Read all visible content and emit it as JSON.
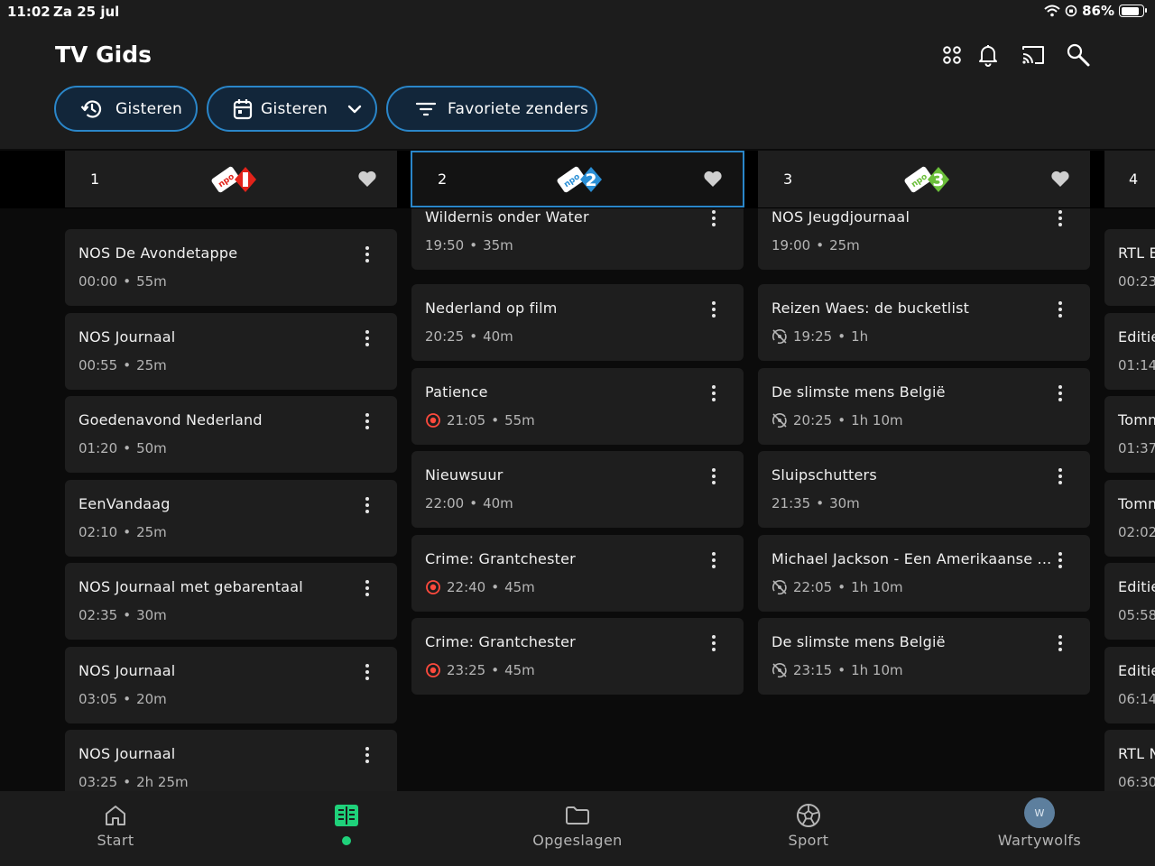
{
  "status_bar": {
    "time": "11:02",
    "date": "Za 25 jul",
    "battery": "86%"
  },
  "header": {
    "title": "TV Gids"
  },
  "filters": [
    {
      "label": "Gisteren",
      "icon": "history-icon"
    },
    {
      "label": "Gisteren",
      "icon": "calendar-icon"
    },
    {
      "label": "Favoriete zenders",
      "icon": "filter-icon"
    }
  ],
  "channels": [
    {
      "number": "1",
      "logo": "npo-1-logo",
      "accent": "#e2231a"
    },
    {
      "number": "2",
      "logo": "npo-2-logo",
      "accent": "#2a8fd6"
    },
    {
      "number": "3",
      "logo": "npo-3-logo",
      "accent": "#6bbf3a"
    },
    {
      "number": "4"
    }
  ],
  "columns": [
    [
      {
        "title": "NOS De Avondetappe",
        "time": "00:00",
        "duration": "55m"
      },
      {
        "title": "NOS Journaal",
        "time": "00:55",
        "duration": "25m"
      },
      {
        "title": "Goedenavond Nederland",
        "time": "01:20",
        "duration": "50m"
      },
      {
        "title": "EenVandaag",
        "time": "02:10",
        "duration": "25m"
      },
      {
        "title": "NOS Journaal met gebarentaal",
        "time": "02:35",
        "duration": "30m"
      },
      {
        "title": "NOS Journaal",
        "time": "03:05",
        "duration": "20m"
      },
      {
        "title": "NOS Journaal",
        "time": "03:25",
        "duration": "2h 25m"
      }
    ],
    [
      {
        "title": "Wildernis onder Water",
        "time": "19:50",
        "duration": "35m"
      },
      {
        "title": "Nederland op film",
        "time": "20:25",
        "duration": "40m"
      },
      {
        "title": "Patience",
        "time": "21:05",
        "duration": "55m",
        "badge": "record"
      },
      {
        "title": "Nieuwsuur",
        "time": "22:00",
        "duration": "40m"
      },
      {
        "title": "Crime: Grantchester",
        "time": "22:40",
        "duration": "45m",
        "badge": "record"
      },
      {
        "title": "Crime: Grantchester",
        "time": "23:25",
        "duration": "45m",
        "badge": "record"
      }
    ],
    [
      {
        "title": "NOS Jeugdjournaal",
        "time": "19:00",
        "duration": "25m"
      },
      {
        "title": "Reizen Waes: de bucketlist",
        "time": "19:25",
        "duration": "1h",
        "badge": "no-record"
      },
      {
        "title": "De slimste mens België",
        "time": "20:25",
        "duration": "1h 10m",
        "badge": "no-record"
      },
      {
        "title": "Sluipschutters",
        "time": "21:35",
        "duration": "30m"
      },
      {
        "title": "Michael Jackson - Een Amerikaanse ...",
        "time": "22:05",
        "duration": "1h 10m",
        "badge": "no-record"
      },
      {
        "title": "De slimste mens België",
        "time": "23:15",
        "duration": "1h 10m",
        "badge": "no-record"
      }
    ],
    [
      {
        "title": "RTL E",
        "time": "00:23"
      },
      {
        "title": "Editie",
        "time": "01:14"
      },
      {
        "title": "Tomm",
        "time": "01:37"
      },
      {
        "title": "Tomm",
        "time": "02:02"
      },
      {
        "title": "Editie",
        "time": "05:58"
      },
      {
        "title": "Editie",
        "time": "06:14"
      },
      {
        "title": "RTL N",
        "time": "06:30"
      }
    ]
  ],
  "nav": [
    {
      "label": "Start",
      "icon": "home-icon"
    },
    {
      "label": "",
      "icon": "tv-guide-icon",
      "active": true
    },
    {
      "label": "Opgeslagen",
      "icon": "folder-icon"
    },
    {
      "label": "Sport",
      "icon": "football-icon"
    },
    {
      "label": "Wartywolfs",
      "icon": "avatar",
      "avatar_letter": "W"
    }
  ],
  "colors": {
    "accent": "#2a86c9",
    "active": "#1fd17a",
    "record": "#ff4a3d",
    "card": "#1e1e1e"
  }
}
